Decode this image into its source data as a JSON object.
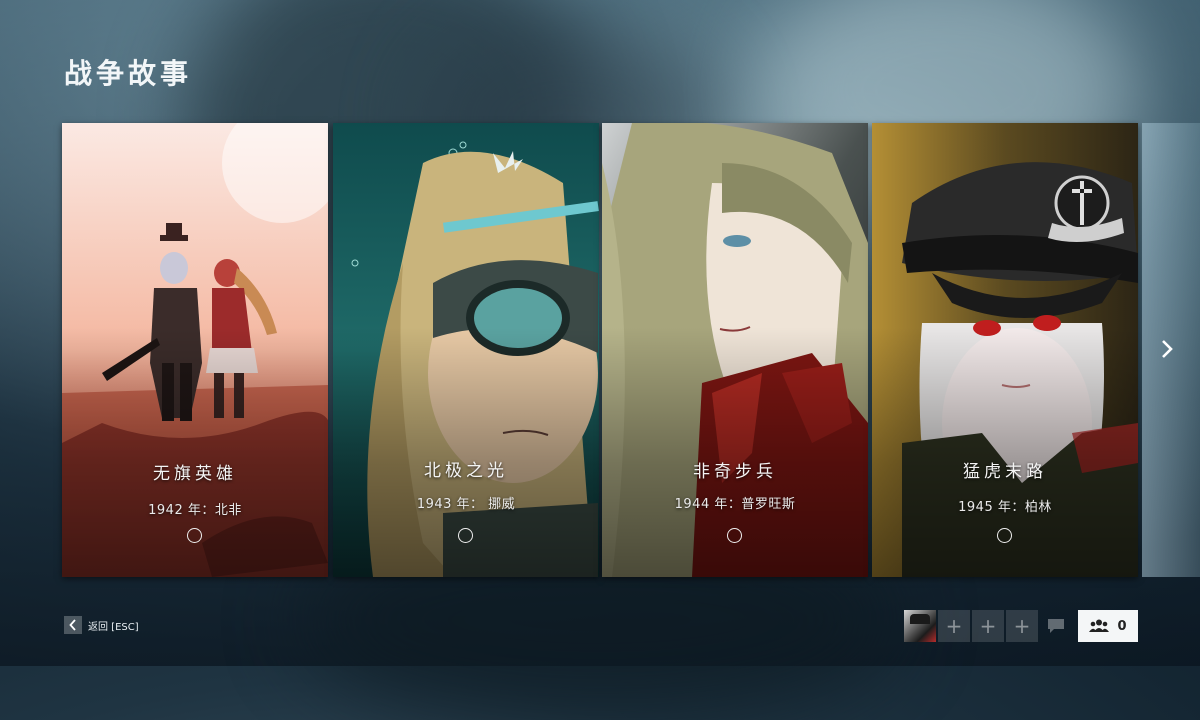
{
  "page": {
    "title": "战争故事"
  },
  "stories": [
    {
      "title": "无旗英雄",
      "subtitle": "1942 年：北非"
    },
    {
      "title": "北极之光",
      "subtitle": "1943 年： 挪威"
    },
    {
      "title": "非奇步兵",
      "subtitle": "1944 年：普罗旺斯"
    },
    {
      "title": "猛虎末路",
      "subtitle": "1945 年：柏林"
    }
  ],
  "nav": {
    "next_icon": "chevron-right-icon",
    "back_label": "返回 [ESC]"
  },
  "squad": {
    "party_count": "0",
    "slots": [
      "+",
      "+",
      "+"
    ]
  },
  "colors": {
    "party_bg": "#f4f6f7",
    "accent": "#ffffff"
  }
}
